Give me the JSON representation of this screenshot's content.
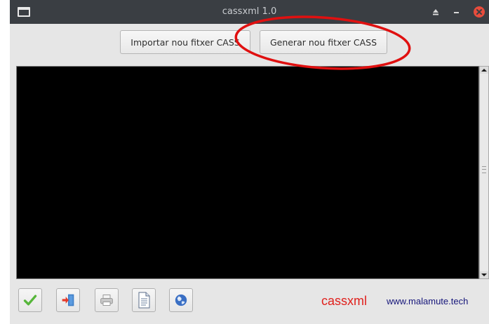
{
  "window": {
    "title": "cassxml 1.0"
  },
  "toolbar": {
    "import_label": "Importar nou fitxer CASS",
    "generate_label": "Generar nou fitxer CASS"
  },
  "bottom": {
    "icons": [
      "check-icon",
      "exit-door-icon",
      "printer-icon",
      "document-icon",
      "globe-icon"
    ],
    "brand": "cassxml",
    "website": "www.malamute.tech"
  },
  "colors": {
    "titlebar": "#3a3e43",
    "close_button": "#e74c3c",
    "console_bg": "#000000",
    "brand_red": "#e0201c",
    "website_blue": "#15157a",
    "annotation_red": "#e01010"
  }
}
